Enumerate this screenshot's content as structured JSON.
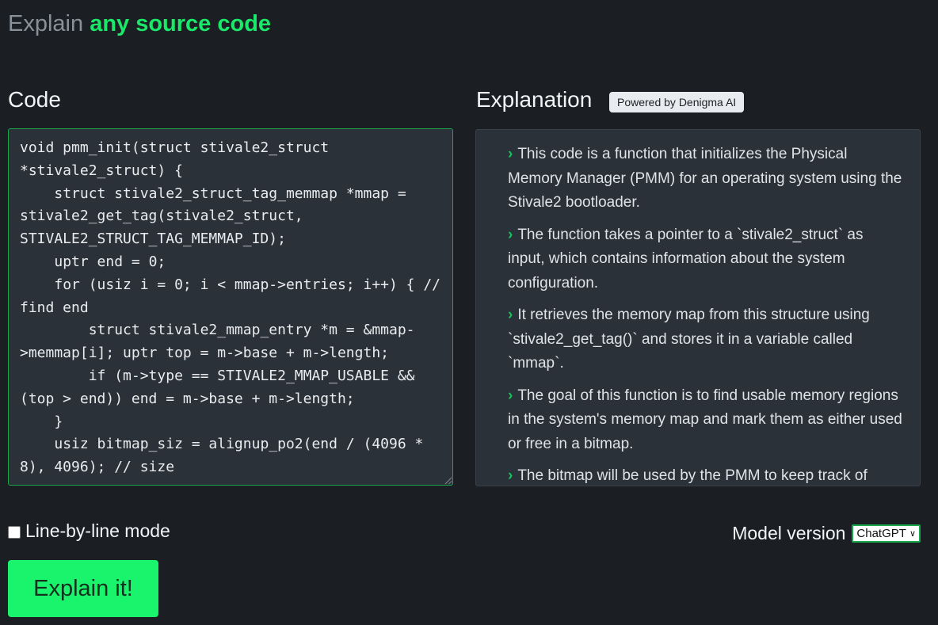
{
  "header": {
    "prefix": "Explain",
    "highlight": "any source code"
  },
  "code_panel": {
    "title": "Code",
    "content": "void pmm_init(struct stivale2_struct *stivale2_struct) {\n    struct stivale2_struct_tag_memmap *mmap = stivale2_get_tag(stivale2_struct, STIVALE2_STRUCT_TAG_MEMMAP_ID);\n    uptr end = 0;\n    for (usiz i = 0; i < mmap->entries; i++) { // find end\n        struct stivale2_mmap_entry *m = &mmap->memmap[i]; uptr top = m->base + m->length;\n        if (m->type == STIVALE2_MMAP_USABLE && (top > end)) end = m->base + m->length;\n    }\n    usiz bitmap_siz = alignup_po2(end / (4096 * 8), 4096); // size"
  },
  "explanation_panel": {
    "title": "Explanation",
    "badge": "Powered by Denigma AI",
    "bullet_icon": "chevron-right-icon",
    "items": [
      "This code is a function that initializes the Physical Memory Manager (PMM) for an operating system using the Stivale2 bootloader.",
      "The function takes a pointer to a `stivale2_struct` as input, which contains information about the system configuration.",
      "It retrieves the memory map from this structure using `stivale2_get_tag()` and stores it in a variable called `mmap`.",
      "The goal of this function is to find usable memory regions in the system's memory map and mark them as either used or free in a bitmap.",
      "The bitmap will be used by the PMM to keep track of"
    ]
  },
  "options": {
    "line_by_line_label": "Line-by-line mode",
    "line_by_line_checked": false,
    "model_label": "Model version",
    "model_selected": "ChatGPT"
  },
  "actions": {
    "explain_label": "Explain it!"
  },
  "colors": {
    "background": "#1b1e22",
    "accent": "#19e86a",
    "button": "#19f46c",
    "panel": "#2b3139"
  }
}
